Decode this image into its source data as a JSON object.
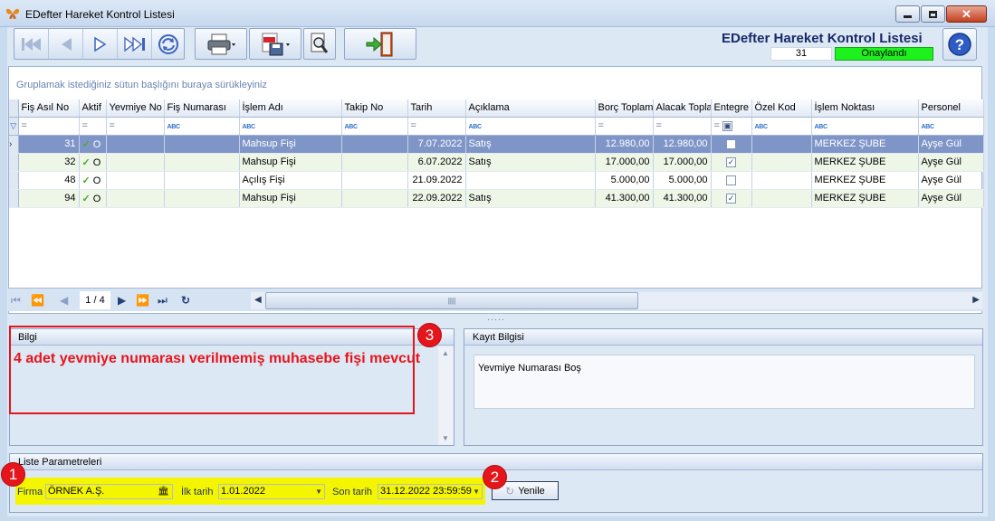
{
  "window": {
    "title": "EDefter Hareket Kontrol Listesi"
  },
  "header": {
    "title": "EDefter Hareket Kontrol Listesi",
    "count": "31",
    "status": "Onaylandı",
    "status_color": "#1ef21e"
  },
  "grid": {
    "group_hint": "Gruplamak istediğiniz sütun başlığını buraya sürükleyiniz",
    "columns": [
      "Fiş Asıl No",
      "Aktif",
      "Yevmiye No",
      "Fiş Numarası",
      "İşlem Adı",
      "Takip No",
      "Tarih",
      "Açıklama",
      "Borç Toplamı",
      "Alacak Topla",
      "Entegre",
      "Özel Kod",
      "İşlem Noktası",
      "Personel"
    ],
    "filter_eq": "=",
    "filter_abc": "ABC",
    "rows": [
      {
        "fis_asil_no": "31",
        "aktif_mark": "O",
        "yevmiye_no": "",
        "fis_numarasi": "",
        "islem_adi": "Mahsup Fişi",
        "takip_no": "",
        "tarih": "7.07.2022",
        "aciklama": "Satış",
        "borc": "12.980,00",
        "alacak": "12.980,00",
        "entegre": false,
        "ozel_kod": "",
        "islem_noktasi": "MERKEZ ŞUBE",
        "personel": "Ayşe Gül"
      },
      {
        "fis_asil_no": "32",
        "aktif_mark": "O",
        "yevmiye_no": "",
        "fis_numarasi": "",
        "islem_adi": "Mahsup Fişi",
        "takip_no": "",
        "tarih": "6.07.2022",
        "aciklama": "Satış",
        "borc": "17.000,00",
        "alacak": "17.000,00",
        "entegre": true,
        "ozel_kod": "",
        "islem_noktasi": "MERKEZ ŞUBE",
        "personel": "Ayşe Gül"
      },
      {
        "fis_asil_no": "48",
        "aktif_mark": "O",
        "yevmiye_no": "",
        "fis_numarasi": "",
        "islem_adi": "Açılış Fişi",
        "takip_no": "",
        "tarih": "21.09.2022",
        "aciklama": "",
        "borc": "5.000,00",
        "alacak": "5.000,00",
        "entegre": false,
        "ozel_kod": "",
        "islem_noktasi": "MERKEZ ŞUBE",
        "personel": "Ayşe Gül"
      },
      {
        "fis_asil_no": "94",
        "aktif_mark": "O",
        "yevmiye_no": "",
        "fis_numarasi": "",
        "islem_adi": "Mahsup Fişi",
        "takip_no": "",
        "tarih": "22.09.2022",
        "aciklama": "Satış",
        "borc": "41.300,00",
        "alacak": "41.300,00",
        "entegre": true,
        "ozel_kod": "",
        "islem_noktasi": "MERKEZ ŞUBE",
        "personel": "Ayşe Gül"
      }
    ],
    "navigator": {
      "page_info": "1 / 4"
    }
  },
  "bilgi": {
    "title": "Bilgi",
    "message": "4 adet yevmiye numarası verilmemiş muhasebe fişi mevcut"
  },
  "kayit": {
    "title": "Kayıt Bilgisi",
    "text": "Yevmiye Numarası Boş"
  },
  "params": {
    "title": "Liste Parametreleri",
    "firma_label": "Firma",
    "firma_value": "ÖRNEK A.Ş.",
    "ilk_tarih_label": "İlk tarih",
    "ilk_tarih_value": "1.01.2022",
    "son_tarih_label": "Son tarih",
    "son_tarih_value": "31.12.2022 23:59:59",
    "refresh_label": "Yenile"
  },
  "annotations": {
    "badge1": "1",
    "badge2": "2",
    "badge3": "3",
    "color": "#e5161b"
  }
}
